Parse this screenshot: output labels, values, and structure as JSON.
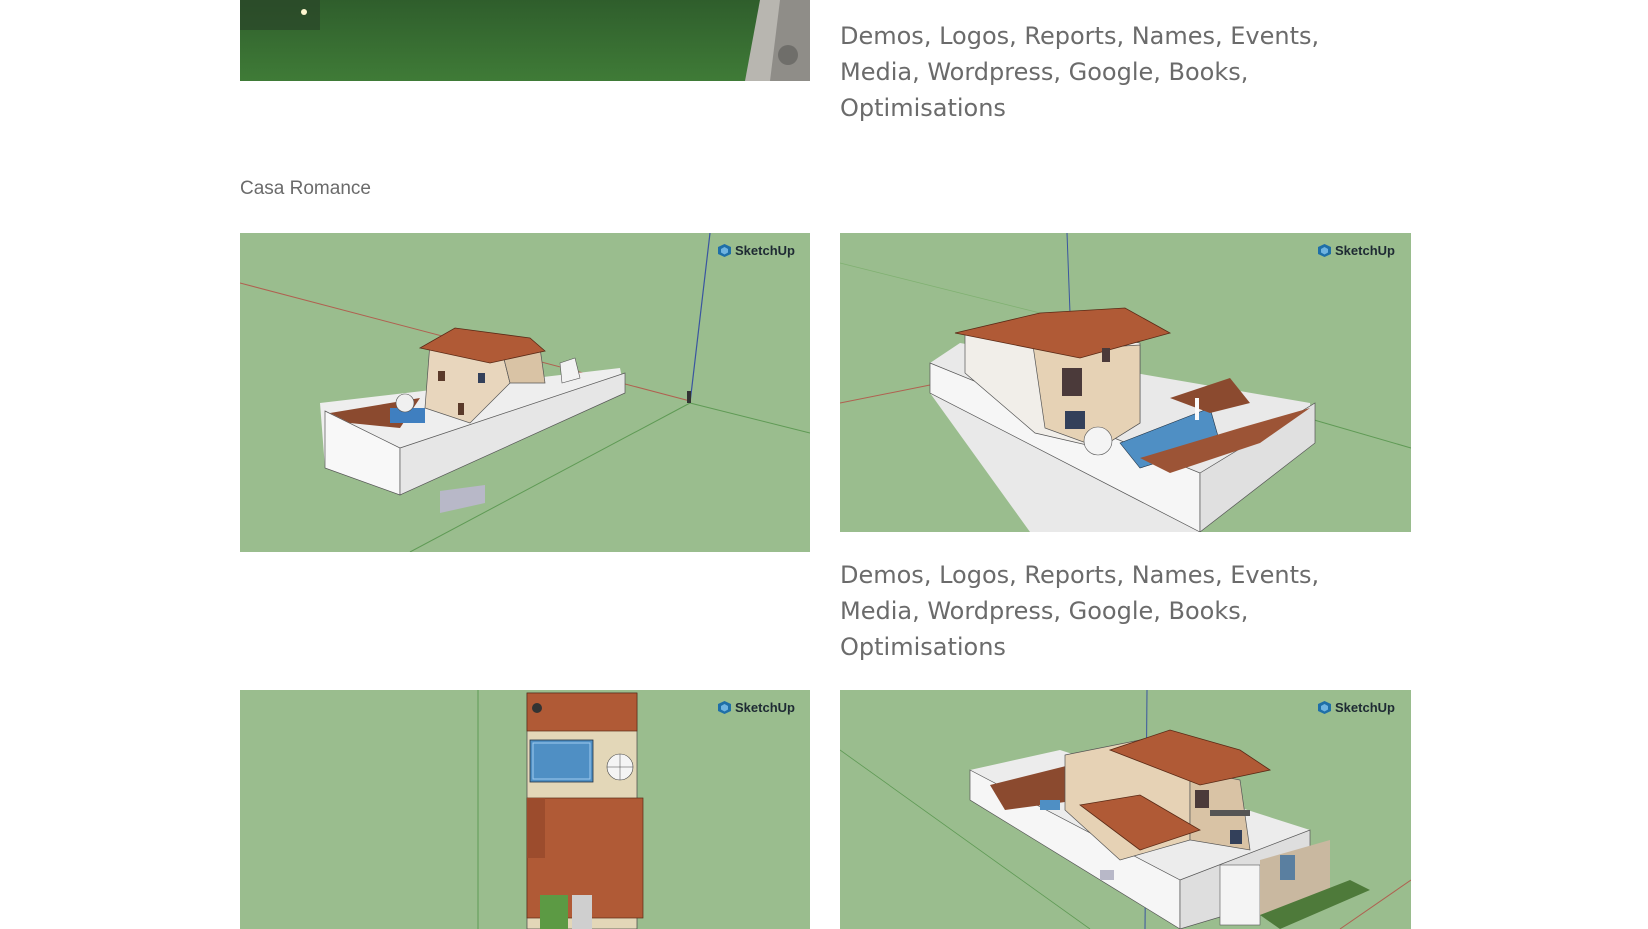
{
  "top_section": {
    "tags_text": "Demos, Logos, Reports, Names, Events, Media, Wordpress, Google, Books, Optimisations"
  },
  "gallery": {
    "title": "Casa Romance",
    "tags_text": "Demos, Logos, Reports, Names, Events, Media, Wordpress, Google, Books, Optimisations",
    "watermark": "SketchUp"
  },
  "colors": {
    "background": "#ffffff",
    "text": "#6b6b6b",
    "model_bg": "#9abd8e",
    "roof": "#b05a36",
    "wall": "#f4f2f0",
    "pool": "#4f8fc4",
    "brand": "#1f6fa8"
  }
}
